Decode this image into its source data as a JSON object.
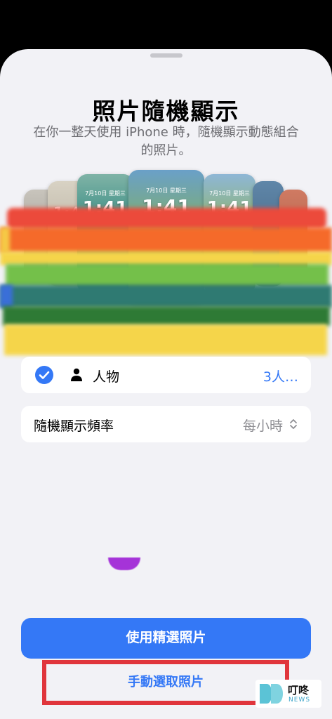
{
  "sheet": {
    "title": "照片隨機顯示",
    "subtitle": "在你一整天使用 iPhone 時，隨機顯示動態組合的照片。"
  },
  "preview": {
    "clock_text": "1:41",
    "date_text": "7月10日 星期三"
  },
  "people_row": {
    "label": "人物",
    "value": "3人…"
  },
  "frequency_row": {
    "label": "隨機顯示頻率",
    "value": "每小時"
  },
  "buttons": {
    "use_featured": "使用精選照片",
    "select_manually": "手動選取照片"
  },
  "watermark": {
    "main": "叮咚",
    "sub": "NEWS"
  },
  "colors": {
    "accent": "#3478f6",
    "sheet_bg": "#f2f2f6",
    "highlight_box": "#e0353c",
    "rainbow": [
      "#ec4a3b",
      "#f56a2a",
      "#f5c946",
      "#74c04a",
      "#2f7a72",
      "#2e7a35",
      "#f5d54a"
    ]
  }
}
